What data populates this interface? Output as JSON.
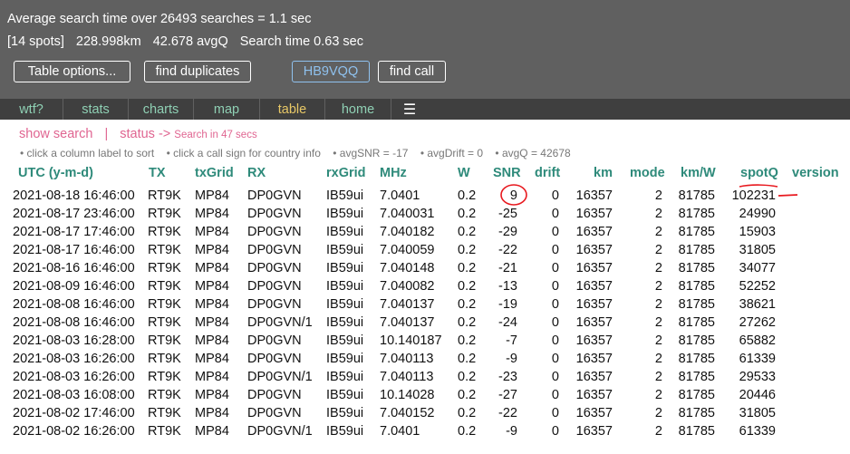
{
  "header": {
    "line1": "Average search time over 26493 searches = 1.1 sec",
    "spots": "[14 spots]",
    "distance": "228.998km",
    "avgq": "42.678 avgQ",
    "search_time": "Search time 0.63 sec"
  },
  "buttons": {
    "table_options": "Table options...",
    "find_duplicates": "find duplicates",
    "callsign": "HB9VQQ",
    "find_call": "find call"
  },
  "nav": {
    "items": [
      "wtf?",
      "stats",
      "charts",
      "map",
      "table",
      "home"
    ],
    "active": "table",
    "menu_icon": "hamburger-menu-icon",
    "menu_glyph": "☰"
  },
  "status": {
    "show_search": "show search",
    "separator": "|",
    "status_label": "status ->",
    "status_detail": "Search in 47 secs"
  },
  "hints": [
    "• click a column label to sort",
    "• click a call sign for country info",
    "• avgSNR = -17",
    "• avgDrift = 0",
    "• avgQ = 42678"
  ],
  "table": {
    "columns": [
      "UTC  (y-m-d)",
      "TX",
      "txGrid",
      "RX",
      "rxGrid",
      "MHz",
      "W",
      "SNR",
      "drift",
      "km",
      "mode",
      "km/W",
      "spotQ",
      "version"
    ],
    "rows": [
      [
        "2021-08-18 16:46:00",
        "RT9K",
        "MP84",
        "DP0GVN",
        "IB59ui",
        "7.0401",
        "0.2",
        "9",
        "0",
        "16357",
        "2",
        "81785",
        "102231",
        ""
      ],
      [
        "2021-08-17 23:46:00",
        "RT9K",
        "MP84",
        "DP0GVN",
        "IB59ui",
        "7.040031",
        "0.2",
        "-25",
        "0",
        "16357",
        "2",
        "81785",
        "24990",
        ""
      ],
      [
        "2021-08-17 17:46:00",
        "RT9K",
        "MP84",
        "DP0GVN",
        "IB59ui",
        "7.040182",
        "0.2",
        "-29",
        "0",
        "16357",
        "2",
        "81785",
        "15903",
        ""
      ],
      [
        "2021-08-17 16:46:00",
        "RT9K",
        "MP84",
        "DP0GVN",
        "IB59ui",
        "7.040059",
        "0.2",
        "-22",
        "0",
        "16357",
        "2",
        "81785",
        "31805",
        ""
      ],
      [
        "2021-08-16 16:46:00",
        "RT9K",
        "MP84",
        "DP0GVN",
        "IB59ui",
        "7.040148",
        "0.2",
        "-21",
        "0",
        "16357",
        "2",
        "81785",
        "34077",
        ""
      ],
      [
        "2021-08-09 16:46:00",
        "RT9K",
        "MP84",
        "DP0GVN",
        "IB59ui",
        "7.040082",
        "0.2",
        "-13",
        "0",
        "16357",
        "2",
        "81785",
        "52252",
        ""
      ],
      [
        "2021-08-08 16:46:00",
        "RT9K",
        "MP84",
        "DP0GVN",
        "IB59ui",
        "7.040137",
        "0.2",
        "-19",
        "0",
        "16357",
        "2",
        "81785",
        "38621",
        ""
      ],
      [
        "2021-08-08 16:46:00",
        "RT9K",
        "MP84",
        "DP0GVN/1",
        "IB59ui",
        "7.040137",
        "0.2",
        "-24",
        "0",
        "16357",
        "2",
        "81785",
        "27262",
        ""
      ],
      [
        "2021-08-03 16:28:00",
        "RT9K",
        "MP84",
        "DP0GVN",
        "IB59ui",
        "10.140187",
        "0.2",
        "-7",
        "0",
        "16357",
        "2",
        "81785",
        "65882",
        ""
      ],
      [
        "2021-08-03 16:26:00",
        "RT9K",
        "MP84",
        "DP0GVN",
        "IB59ui",
        "7.040113",
        "0.2",
        "-9",
        "0",
        "16357",
        "2",
        "81785",
        "61339",
        ""
      ],
      [
        "2021-08-03 16:26:00",
        "RT9K",
        "MP84",
        "DP0GVN/1",
        "IB59ui",
        "7.040113",
        "0.2",
        "-23",
        "0",
        "16357",
        "2",
        "81785",
        "29533",
        ""
      ],
      [
        "2021-08-03 16:08:00",
        "RT9K",
        "MP84",
        "DP0GVN",
        "IB59ui",
        "10.14028",
        "0.2",
        "-27",
        "0",
        "16357",
        "2",
        "81785",
        "20446",
        ""
      ],
      [
        "2021-08-02 17:46:00",
        "RT9K",
        "MP84",
        "DP0GVN",
        "IB59ui",
        "7.040152",
        "0.2",
        "-22",
        "0",
        "16357",
        "2",
        "81785",
        "31805",
        ""
      ],
      [
        "2021-08-02 16:26:00",
        "RT9K",
        "MP84",
        "DP0GVN/1",
        "IB59ui",
        "7.0401",
        "0.2",
        "-9",
        "0",
        "16357",
        "2",
        "81785",
        "61339",
        ""
      ]
    ]
  },
  "colors": {
    "header_bg": "#606060",
    "nav_bg": "#3f3f3f",
    "nav_link": "#8fd0b4",
    "nav_active": "#e7c766",
    "column_header": "#2e8a7a",
    "pink": "#e06591",
    "annotation_red": "#e8191f",
    "callsign_button": "#8fc1ee"
  }
}
